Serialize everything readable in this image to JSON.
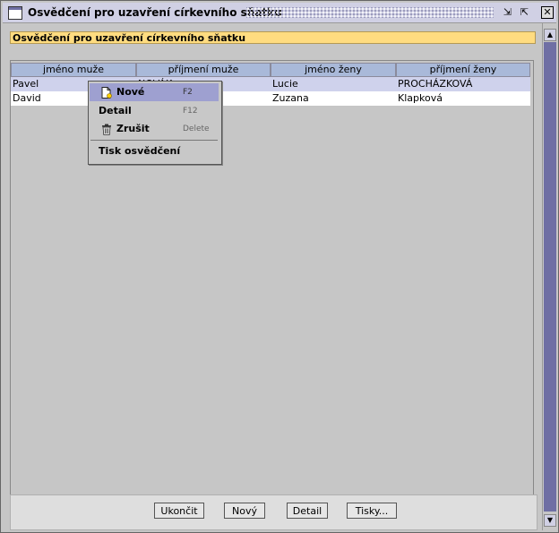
{
  "window": {
    "title": "Osvědčení pro uzavření církevního sňatku",
    "controls": [
      "restore-icon",
      "maximize-icon",
      "close-icon"
    ]
  },
  "header_strip": "Osvědčení pro uzavření církevního sňatku",
  "table": {
    "columns": [
      "jméno muže",
      "příjmení muže",
      "jméno ženy",
      "příjmení ženy"
    ],
    "rows": [
      [
        "Pavel",
        "NOVÁK",
        "Lucie",
        "PROCHÁZKOVÁ"
      ],
      [
        "David",
        "",
        "Zuzana",
        "Klapková"
      ]
    ]
  },
  "context_menu": {
    "items": [
      {
        "label": "Nové",
        "accelerator": "F2",
        "icon": "new-document-icon"
      },
      {
        "label": "Detail",
        "accelerator": "F12"
      },
      {
        "label": "Zrušit",
        "accelerator": "Delete",
        "icon": "trash-icon"
      },
      {
        "label": "Tisk osvědčení"
      }
    ]
  },
  "buttons": {
    "ukoncit": "Ukončit",
    "novy": "Nový",
    "detail": "Detail",
    "tisky": "Tisky..."
  },
  "colors": {
    "title_bar": "#d0d0e4",
    "header_strip": "#ffdc80",
    "selected_row": "#cfd2ec",
    "table_header": "#a9b9d9",
    "menu_highlight": "#9ea0d0",
    "scroll_track": "#6f6fa4"
  }
}
